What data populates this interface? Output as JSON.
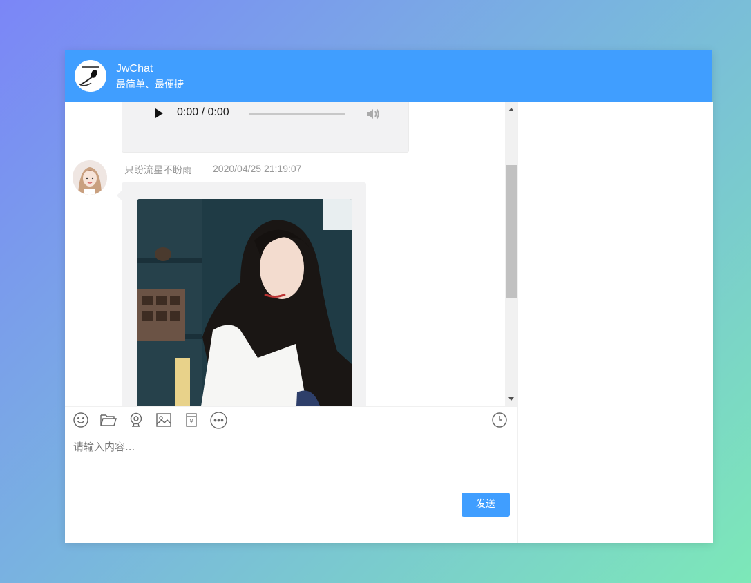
{
  "header": {
    "title": "JwChat",
    "subtitle": "最简单、最便捷"
  },
  "messages": [
    {
      "type": "audio",
      "time_display": "0:00 / 0:00"
    },
    {
      "type": "image",
      "name": "只盼流星不盼雨",
      "time": "2020/04/25 21:19:07"
    }
  ],
  "toolbar": {
    "icons": [
      "emoji-icon",
      "folder-icon",
      "camera-icon",
      "image-icon",
      "red-packet-icon",
      "more-icon",
      "history-icon"
    ],
    "red_packet_symbol": "¥"
  },
  "input": {
    "placeholder": "请输入内容..."
  },
  "send_label": "发送",
  "colors": {
    "primary": "#409eff",
    "bubble": "#f2f2f3"
  }
}
